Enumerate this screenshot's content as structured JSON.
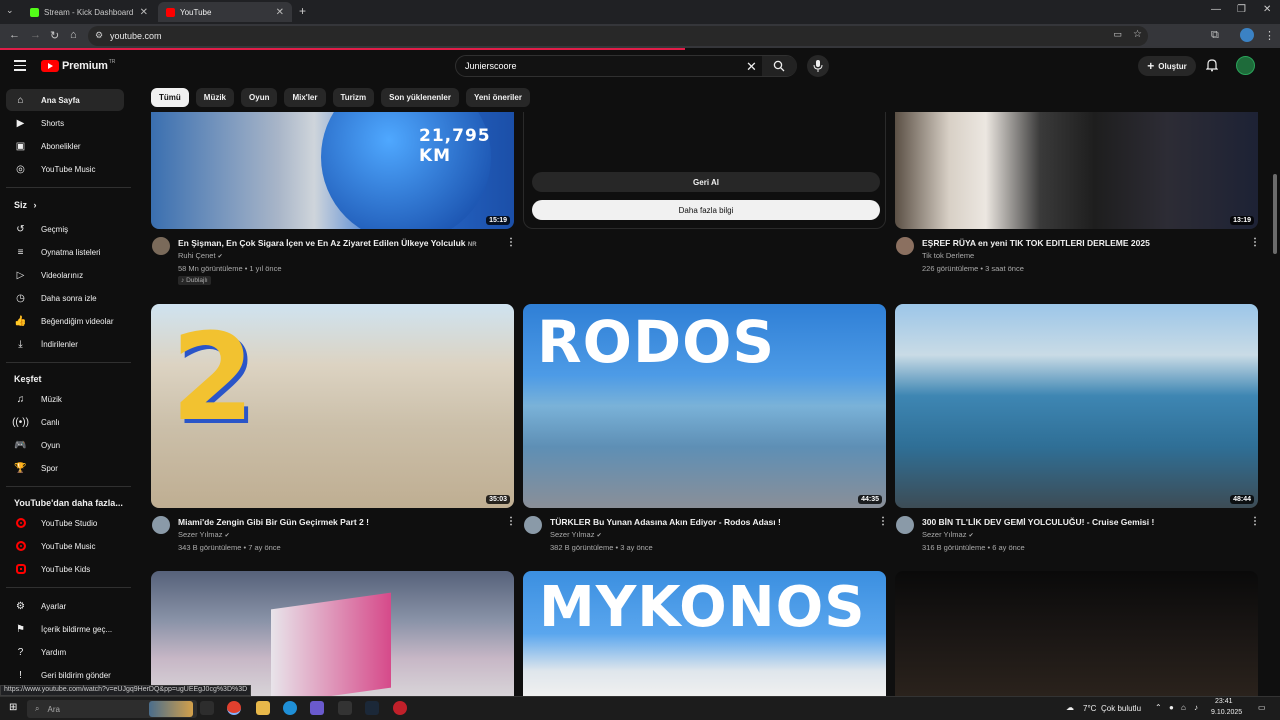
{
  "browser": {
    "tabs": [
      {
        "title": "Stream - Kick Dashboard",
        "favicon_color": "#53fc18"
      },
      {
        "title": "YouTube",
        "favicon_color": "#ff0000"
      }
    ],
    "new_tab": "+",
    "url": "youtube.com",
    "status_url": "https://www.youtube.com/watch?v=eUJgq9HerDQ&pp=ugUEEgJ0cg%3D%3D"
  },
  "header": {
    "logo_text": "Premium",
    "logo_region": "TR",
    "search_value": "Junierscoore",
    "create_label": "Oluştur"
  },
  "chips": [
    "Tümü",
    "Müzik",
    "Oyun",
    "Mix'ler",
    "Turizm",
    "Son yüklenenler",
    "Yeni öneriler"
  ],
  "sidebar": {
    "main": [
      {
        "label": "Ana Sayfa",
        "icon": "home-icon"
      },
      {
        "label": "Shorts",
        "icon": "shorts-icon"
      },
      {
        "label": "Abonelikler",
        "icon": "subscriptions-icon"
      },
      {
        "label": "YouTube Music",
        "icon": "music-circle-icon"
      }
    ],
    "you_header": "Siz",
    "you": [
      {
        "label": "Geçmiş",
        "icon": "history-icon"
      },
      {
        "label": "Oynatma listeleri",
        "icon": "playlists-icon"
      },
      {
        "label": "Videolarınız",
        "icon": "your-videos-icon"
      },
      {
        "label": "Daha sonra izle",
        "icon": "watch-later-icon"
      },
      {
        "label": "Beğendiğim videolar",
        "icon": "liked-icon"
      },
      {
        "label": "İndirilenler",
        "icon": "download-icon"
      }
    ],
    "explore_header": "Keşfet",
    "explore": [
      {
        "label": "Müzik",
        "icon": "music-note-icon"
      },
      {
        "label": "Canlı",
        "icon": "live-icon"
      },
      {
        "label": "Oyun",
        "icon": "gaming-icon"
      },
      {
        "label": "Spor",
        "icon": "trophy-icon"
      }
    ],
    "more_header": "YouTube'dan daha fazla...",
    "more": [
      {
        "label": "YouTube Studio"
      },
      {
        "label": "YouTube Music"
      },
      {
        "label": "YouTube Kids"
      }
    ],
    "settings": [
      {
        "label": "Ayarlar",
        "icon": "gear-icon"
      },
      {
        "label": "İçerik bildirme geç...",
        "icon": "flag-icon"
      },
      {
        "label": "Yardım",
        "icon": "help-icon"
      },
      {
        "label": "Geri bildirim gönder",
        "icon": "feedback-icon"
      }
    ]
  },
  "panel": {
    "undo_label": "Geri Al",
    "more_info_label": "Daha fazla bilgi"
  },
  "videos_row1": [
    {
      "title": "En Şişman, En Çok Sigara İçen ve En Az Ziyaret Edilen Ülkeye Yolculuk",
      "badge_nr": "NR",
      "thumb_overlay": "21,795 KM",
      "duration": "15:19",
      "channel": "Ruhi Çenet",
      "views": "58 Mn görüntüleme",
      "age": "1 yıl önce",
      "tag": "Dublajlı"
    },
    {
      "title": "EŞREF RÜYA en yeni TIK TOK EDITLERI DERLEME 2025",
      "duration": "13:19",
      "channel": "Tik tok Derleme",
      "views": "226 görüntüleme",
      "age": "3 saat önce"
    }
  ],
  "videos_row2": [
    {
      "title": "Miami'de Zengin Gibi Bir Gün Geçirmek Part 2 !",
      "thumb_overlay": "2",
      "duration": "35:03",
      "channel": "Sezer Yılmaz",
      "views": "343 B görüntüleme",
      "age": "7 ay önce"
    },
    {
      "title": "TÜRKLER Bu Yunan Adasına Akın Ediyor - Rodos Adası !",
      "thumb_overlay": "RODOS",
      "duration": "44:35",
      "channel": "Sezer Yılmaz",
      "views": "382 B görüntüleme",
      "age": "3 ay önce"
    },
    {
      "title": "300 BİN TL'LİK DEV GEMİ YOLCULUĞU! - Cruise Gemisi !",
      "duration": "48:44",
      "channel": "Sezer Yılmaz",
      "views": "316 B görüntüleme",
      "age": "6 ay önce"
    }
  ],
  "videos_row3": [
    {
      "thumb_overlay": ""
    },
    {
      "thumb_overlay": "MYKONOS"
    },
    {
      "thumb_overlay": ""
    }
  ],
  "taskbar": {
    "search_placeholder": "Ara",
    "weather": "7°C",
    "weather_text": "Çok bulutlu",
    "time": "23:41",
    "date": "9.10.2025"
  }
}
